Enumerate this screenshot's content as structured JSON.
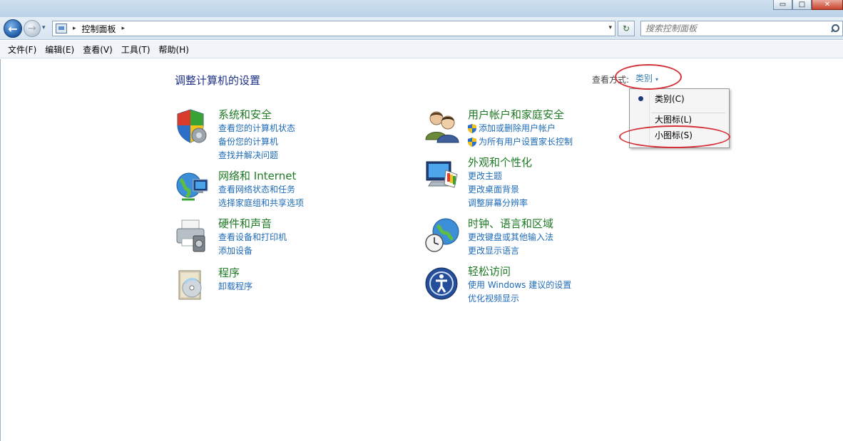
{
  "window": {
    "title": "",
    "controls": {
      "minimize": "▭",
      "maximize": "□",
      "close": "✕"
    }
  },
  "nav": {
    "back": "←",
    "forward": "→",
    "recent": "▾",
    "breadcrumb": "控制面板",
    "crumb_arrow": "▸",
    "dropdown": "▾",
    "refresh": "↻",
    "search_placeholder": "搜索控制面板"
  },
  "menubar": [
    "文件(F)",
    "编辑(E)",
    "查看(V)",
    "工具(T)",
    "帮助(H)"
  ],
  "content": {
    "heading": "调整计算机的设置",
    "view_by_label": "查看方式:",
    "view_by_value": "类别",
    "view_by_caret": "▾"
  },
  "categories": {
    "system": {
      "title": "系统和安全",
      "links": [
        "查看您的计算机状态",
        "备份您的计算机",
        "查找并解决问题"
      ]
    },
    "network": {
      "title": "网络和 Internet",
      "links": [
        "查看网络状态和任务",
        "选择家庭组和共享选项"
      ]
    },
    "hardware": {
      "title": "硬件和声音",
      "links": [
        "查看设备和打印机",
        "添加设备"
      ]
    },
    "programs": {
      "title": "程序",
      "links": [
        "卸载程序"
      ]
    },
    "users": {
      "title": "用户帐户和家庭安全",
      "links": [
        "添加或删除用户帐户",
        "为所有用户设置家长控制"
      ]
    },
    "appearance": {
      "title": "外观和个性化",
      "links": [
        "更改主题",
        "更改桌面背景",
        "调整屏幕分辨率"
      ]
    },
    "clock": {
      "title": "时钟、语言和区域",
      "links": [
        "更改键盘或其他输入法",
        "更改显示语言"
      ]
    },
    "ease": {
      "title": "轻松访问",
      "links": [
        "使用 Windows 建议的设置",
        "优化视频显示"
      ]
    }
  },
  "view_menu": {
    "items": [
      "类别(C)",
      "大图标(L)",
      "小图标(S)"
    ],
    "selected": "类别(C)"
  },
  "colors": {
    "accent": "#1e6bb8",
    "category_title": "#1f7a25",
    "annotation": "#d3303a"
  }
}
